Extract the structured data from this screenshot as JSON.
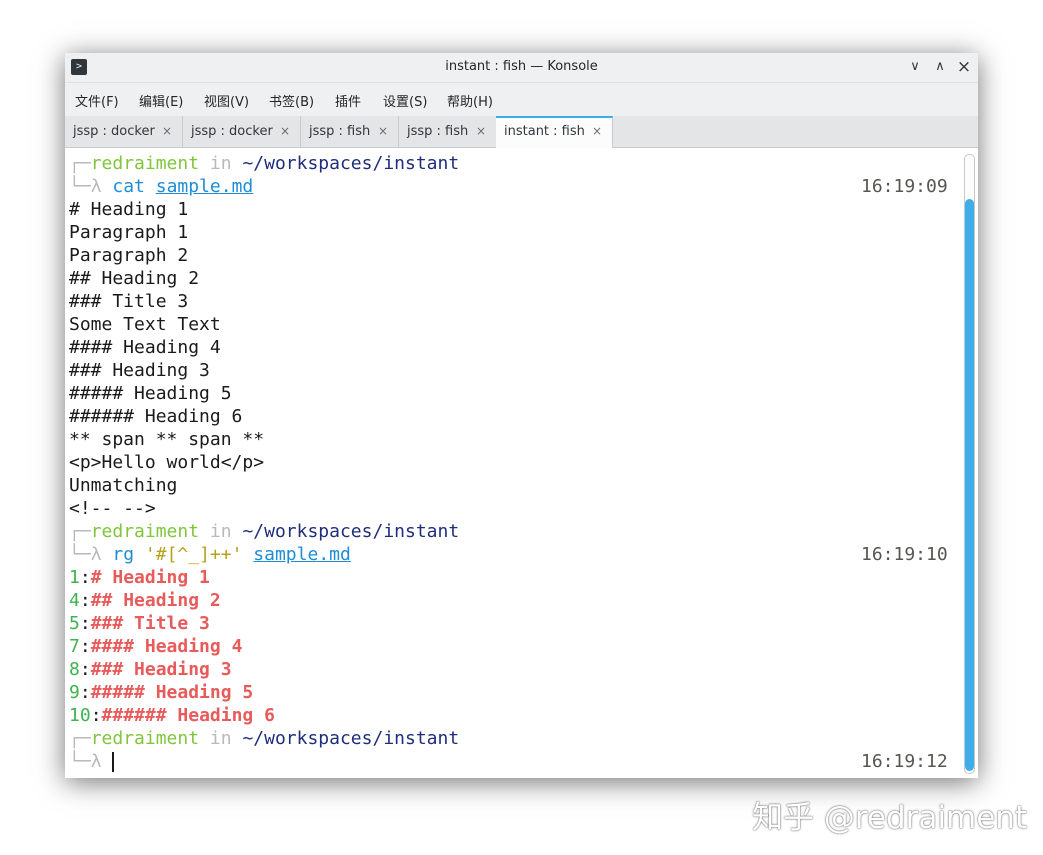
{
  "window": {
    "title": "instant : fish — Konsole",
    "icon": "terminal-icon",
    "minimize": "∨",
    "maximize": "∧",
    "close": "×"
  },
  "menu": [
    "文件(F)",
    "编辑(E)",
    "视图(V)",
    "书签(B)",
    "插件",
    "设置(S)",
    "帮助(H)"
  ],
  "tabs": [
    {
      "label": "jssp : docker",
      "active": false
    },
    {
      "label": "jssp : docker",
      "active": false
    },
    {
      "label": "jssp : fish",
      "active": false
    },
    {
      "label": "jssp : fish",
      "active": false
    },
    {
      "label": "instant : fish",
      "active": true
    }
  ],
  "tab_close": "×",
  "prompt": {
    "corner_top": "┌─",
    "corner_bottom": "└─",
    "user": "redraiment",
    "in": "in",
    "path": "~/workspaces/instant",
    "lambda": "λ"
  },
  "session": {
    "cmd1": {
      "command": "cat",
      "arg": "sample.md",
      "time": "16:19:09"
    },
    "output1": [
      "# Heading 1",
      "Paragraph 1",
      "Paragraph 2",
      "## Heading 2",
      "### Title 3",
      "Some Text Text",
      "#### Heading 4",
      "### Heading 3",
      "##### Heading 5",
      "###### Heading 6",
      "** span ** span **",
      "<p>Hello world</p>",
      "Unmatching",
      "<!-- -->"
    ],
    "cmd2": {
      "command": "rg",
      "pattern": "'#[^_]++'",
      "arg": "sample.md",
      "time": "16:19:10"
    },
    "output2": [
      {
        "num": "1",
        "text": "# Heading 1"
      },
      {
        "num": "4",
        "text": "## Heading 2"
      },
      {
        "num": "5",
        "text": "### Title 3"
      },
      {
        "num": "7",
        "text": "#### Heading 4"
      },
      {
        "num": "8",
        "text": "### Heading 3"
      },
      {
        "num": "9",
        "text": "##### Heading 5"
      },
      {
        "num": "10",
        "text": "###### Heading 6"
      }
    ],
    "cmd3": {
      "time": "16:19:12"
    }
  },
  "watermark": "知乎 @redraiment",
  "colors": {
    "accent": "#3daee9",
    "user": "#7ec73a",
    "path": "#1f2e7c",
    "command": "#1d8dd6",
    "match": "#e85b5b",
    "line_number": "#3eb34f"
  }
}
